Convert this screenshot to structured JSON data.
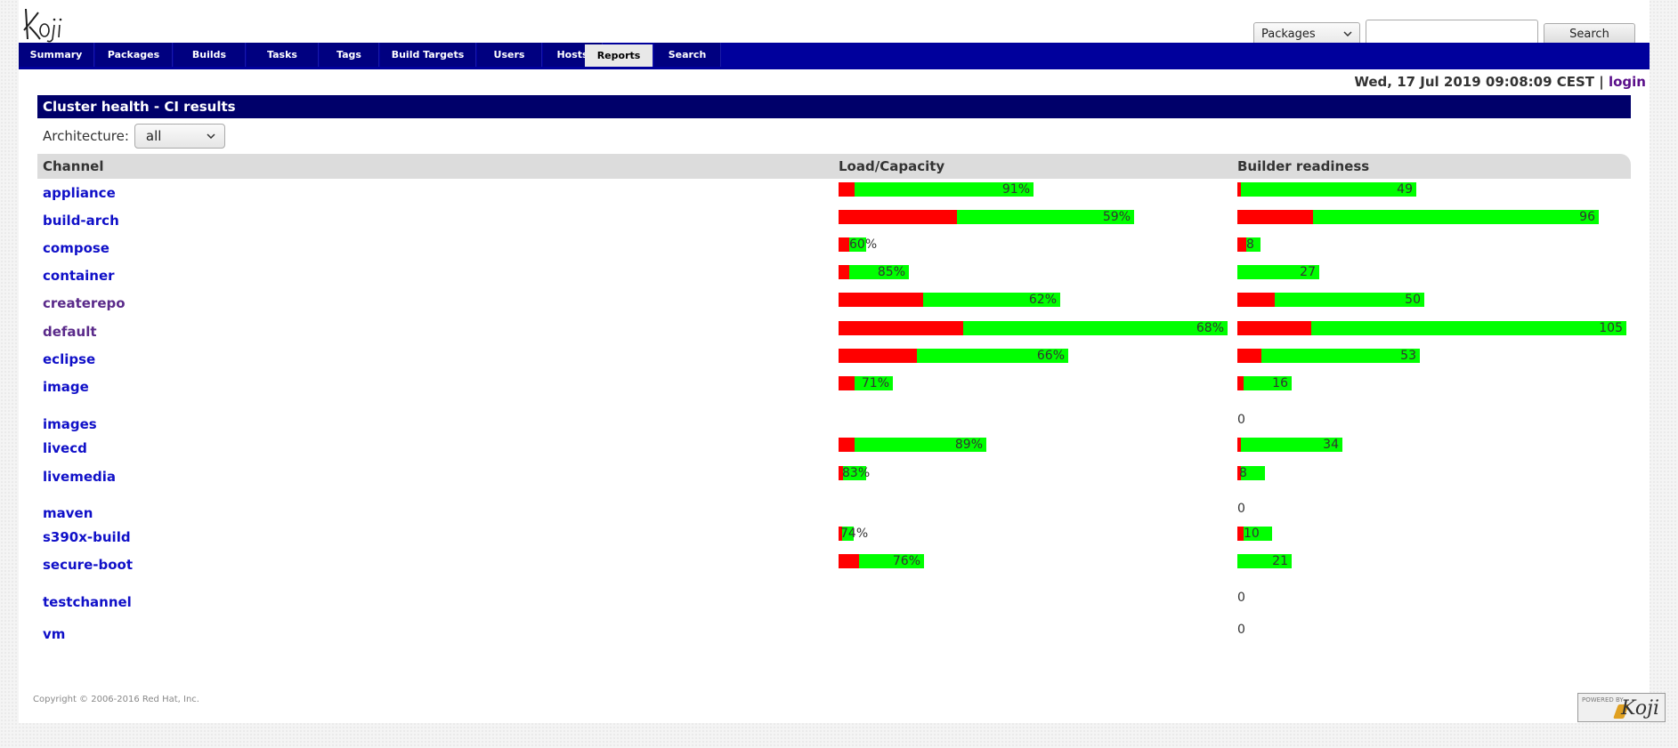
{
  "header": {
    "logo_text": "Koji",
    "search_type": "Packages",
    "search_value": "",
    "search_button": "Search"
  },
  "nav": {
    "tabs": [
      {
        "label": "Summary",
        "active": false
      },
      {
        "label": "Packages",
        "active": false
      },
      {
        "label": "Builds",
        "active": false
      },
      {
        "label": "Tasks",
        "active": false
      },
      {
        "label": "Tags",
        "active": false
      },
      {
        "label": "Build Targets",
        "active": false
      },
      {
        "label": "Users",
        "active": false
      },
      {
        "label": "Hosts",
        "active": false
      },
      {
        "label": "Reports",
        "active": true
      },
      {
        "label": "Search",
        "active": false
      }
    ]
  },
  "datebar": {
    "date": "Wed, 17 Jul 2019 09:08:09 CEST",
    "separator": "|",
    "login": "login"
  },
  "panel": {
    "title": "Cluster health - CI results",
    "arch_label": "Architecture:",
    "arch_value": "all",
    "columns": {
      "channel": "Channel",
      "load": "Load/Capacity",
      "ready": "Builder readiness"
    }
  },
  "channels": [
    {
      "name": "appliance",
      "visited": false,
      "load": {
        "red": 0.08,
        "green": 0.92,
        "total": 0.5,
        "label": "91%"
      },
      "ready": {
        "red": 0.02,
        "green": 0.98,
        "total": 0.46,
        "label": "49"
      }
    },
    {
      "name": "build-arch",
      "visited": false,
      "load": {
        "red": 0.4,
        "green": 0.6,
        "total": 0.76,
        "label": "59%"
      },
      "ready": {
        "red": 0.21,
        "green": 0.79,
        "total": 0.93,
        "label": "96"
      }
    },
    {
      "name": "compose",
      "visited": false,
      "load": {
        "red": 0.4,
        "green": 0.6,
        "total": 0.07,
        "label": "60%"
      },
      "ready": {
        "red": 0.39,
        "green": 0.61,
        "total": 0.06,
        "label": "8"
      }
    },
    {
      "name": "container",
      "visited": false,
      "load": {
        "red": 0.15,
        "green": 0.85,
        "total": 0.18,
        "label": "85%"
      },
      "ready": {
        "red": 0.0,
        "green": 1.0,
        "total": 0.21,
        "label": "27"
      }
    },
    {
      "name": "createrepo",
      "visited": true,
      "load": {
        "red": 0.38,
        "green": 0.62,
        "total": 0.57,
        "label": "62%"
      },
      "ready": {
        "red": 0.2,
        "green": 0.8,
        "total": 0.48,
        "label": "50"
      }
    },
    {
      "name": "default",
      "visited": true,
      "load": {
        "red": 0.32,
        "green": 0.68,
        "total": 1.0,
        "label": "68%"
      },
      "ready": {
        "red": 0.19,
        "green": 0.81,
        "total": 1.0,
        "label": "105"
      }
    },
    {
      "name": "eclipse",
      "visited": false,
      "load": {
        "red": 0.34,
        "green": 0.66,
        "total": 0.59,
        "label": "66%"
      },
      "ready": {
        "red": 0.13,
        "green": 0.87,
        "total": 0.47,
        "label": "53"
      }
    },
    {
      "name": "image",
      "visited": false,
      "load": {
        "red": 0.29,
        "green": 0.71,
        "total": 0.14,
        "label": "71%"
      },
      "ready": {
        "red": 0.11,
        "green": 0.89,
        "total": 0.14,
        "label": "16"
      }
    },
    {
      "name": "images",
      "visited": false,
      "load": null,
      "ready": null,
      "zero": "0"
    },
    {
      "name": "livecd",
      "visited": false,
      "load": {
        "red": 0.11,
        "green": 0.89,
        "total": 0.38,
        "label": "89%"
      },
      "ready": {
        "red": 0.03,
        "green": 0.97,
        "total": 0.27,
        "label": "34"
      }
    },
    {
      "name": "livemedia",
      "visited": false,
      "load": {
        "red": 0.17,
        "green": 0.83,
        "total": 0.07,
        "label": "83%"
      },
      "ready": {
        "red": 0.13,
        "green": 0.87,
        "total": 0.07,
        "label": "8"
      }
    },
    {
      "name": "maven",
      "visited": false,
      "load": null,
      "ready": null,
      "zero": "0"
    },
    {
      "name": "s390x-build",
      "visited": false,
      "load": {
        "red": 0.26,
        "green": 0.74,
        "total": 0.04,
        "label": "74%"
      },
      "ready": {
        "red": 0.17,
        "green": 0.83,
        "total": 0.09,
        "label": "10"
      }
    },
    {
      "name": "secure-boot",
      "visited": false,
      "load": {
        "red": 0.24,
        "green": 0.76,
        "total": 0.22,
        "label": "76%"
      },
      "ready": {
        "red": 0.0,
        "green": 1.0,
        "total": 0.14,
        "label": "21"
      }
    },
    {
      "name": "testchannel",
      "visited": false,
      "load": null,
      "ready": null,
      "zero": "0"
    },
    {
      "name": "vm",
      "visited": false,
      "load": null,
      "ready": null,
      "zero": "0"
    }
  ],
  "footer": {
    "copyright": "Copyright © 2006-2016 Red Hat, Inc.",
    "powered_by": "POWERED BY",
    "powered_logo": "Koji"
  }
}
